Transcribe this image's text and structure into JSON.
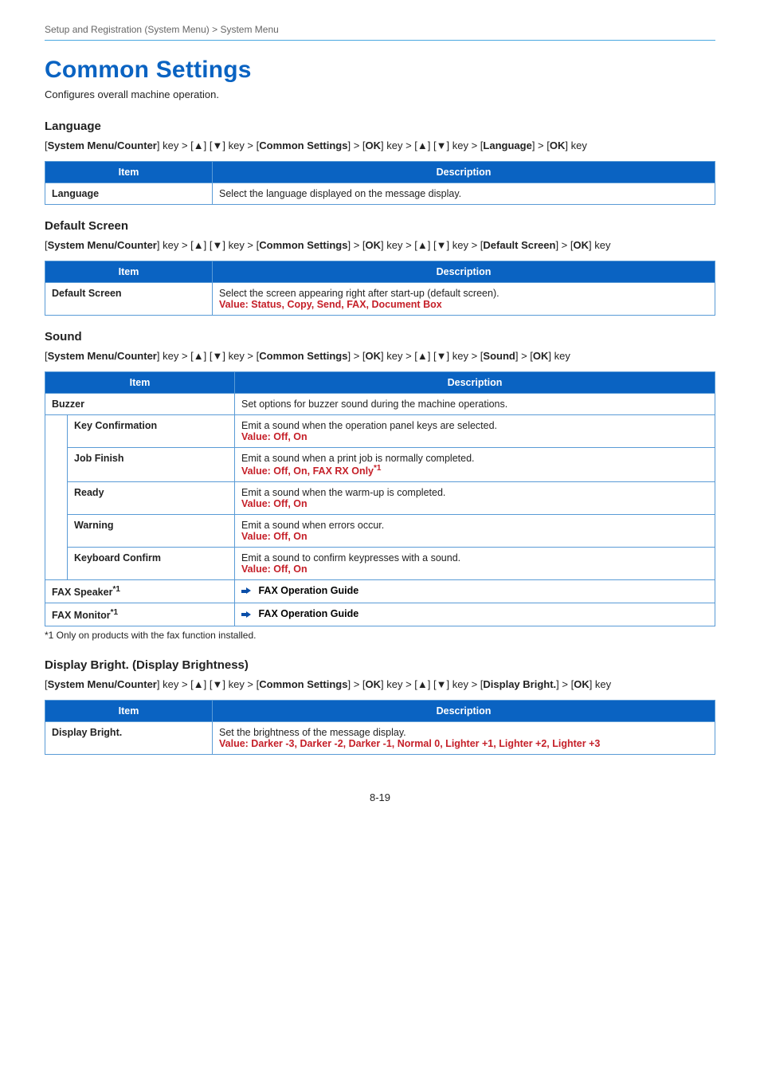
{
  "breadcrumb": "Setup and Registration (System Menu) > System Menu",
  "title": "Common Settings",
  "intro": "Configures overall machine operation.",
  "tableHeaders": {
    "item": "Item",
    "description": "Description"
  },
  "nav": {
    "prefix_bold": "System Menu/Counter",
    "key_gt": "] key > [",
    "up": "▲",
    "down": "▼",
    "key_gt2": "] key > [",
    "common_settings": "Common Settings",
    "ok_key_gt": "] key > [",
    "ok": "OK",
    "key_gt3": "] key > [",
    "key": "] key",
    "open": "[",
    "close": "]"
  },
  "language": {
    "heading": "Language",
    "nav_target": "Language",
    "item": "Language",
    "desc": "Select the language displayed on the message display."
  },
  "defaultScreen": {
    "heading": "Default Screen",
    "nav_target": "Default Screen",
    "item": "Default Screen",
    "desc": "Select the screen appearing right after start-up (default screen).",
    "value_label": "Value",
    "value_body": ": Status, Copy, Send, FAX, Document Box"
  },
  "sound": {
    "heading": "Sound",
    "nav_target": "Sound",
    "buzzer": {
      "item": "Buzzer",
      "desc": "Set options for buzzer sound during the machine operations."
    },
    "rows": [
      {
        "item": "Key Confirmation",
        "desc": "Emit a sound when the operation panel keys are selected.",
        "value_body": ": Off, On"
      },
      {
        "item": "Job Finish",
        "desc": "Emit a sound when a print job is normally completed.",
        "value_body": ": Off, On, FAX RX Only",
        "sup": "*1"
      },
      {
        "item": "Ready",
        "desc": "Emit a sound when the warm-up is completed.",
        "value_body": ": Off, On"
      },
      {
        "item": "Warning",
        "desc": "Emit a sound when errors occur.",
        "value_body": ": Off, On"
      },
      {
        "item": "Keyboard Confirm",
        "desc": "Emit a sound to confirm keypresses with a sound.",
        "value_body": ": Off, On"
      }
    ],
    "value_label": "Value",
    "faxSpeaker": {
      "item": "FAX Speaker",
      "sup": "*1",
      "ref": "FAX Operation Guide"
    },
    "faxMonitor": {
      "item": "FAX Monitor",
      "sup": "*1",
      "ref": "FAX Operation Guide"
    },
    "footnote": "*1   Only on products with the fax function installed."
  },
  "displayBright": {
    "heading": "Display Bright. (Display Brightness)",
    "nav_target": "Display Bright.",
    "item": "Display Bright.",
    "desc": "Set the brightness of the message display.",
    "value_label": "Value",
    "value_body": ": Darker -3, Darker -2, Darker -1, Normal 0, Lighter +1, Lighter +2, Lighter +3"
  },
  "pageNumber": "8-19"
}
